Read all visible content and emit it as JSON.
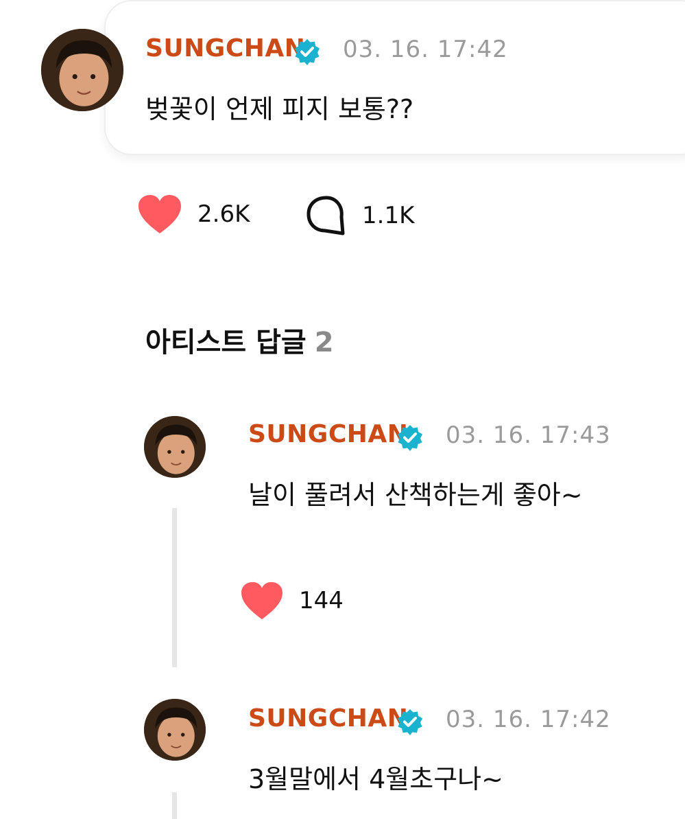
{
  "post": {
    "author": "SUNGCHAN",
    "timestamp": "03. 16. 17:42",
    "text": "벚꽃이 언제 피지 보통??",
    "likes": "2.6K",
    "comments": "1.1K"
  },
  "replies_section": {
    "title": "아티스트 답글",
    "count": "2"
  },
  "replies": [
    {
      "author": "SUNGCHAN",
      "timestamp": "03. 16. 17:43",
      "text": "날이 풀려서 산책하는게 좋아~",
      "likes": "144"
    },
    {
      "author": "SUNGCHAN",
      "timestamp": "03. 16. 17:42",
      "text": "3월말에서 4월초구나~"
    }
  ],
  "colors": {
    "author": "#cc4a15",
    "verified": "#19b3cf",
    "heart": "#ff5a5f",
    "timestamp": "#9a9a9a"
  },
  "icons": {
    "verified": "verified-badge-icon",
    "like": "heart-icon",
    "comment": "comment-bubble-icon"
  }
}
